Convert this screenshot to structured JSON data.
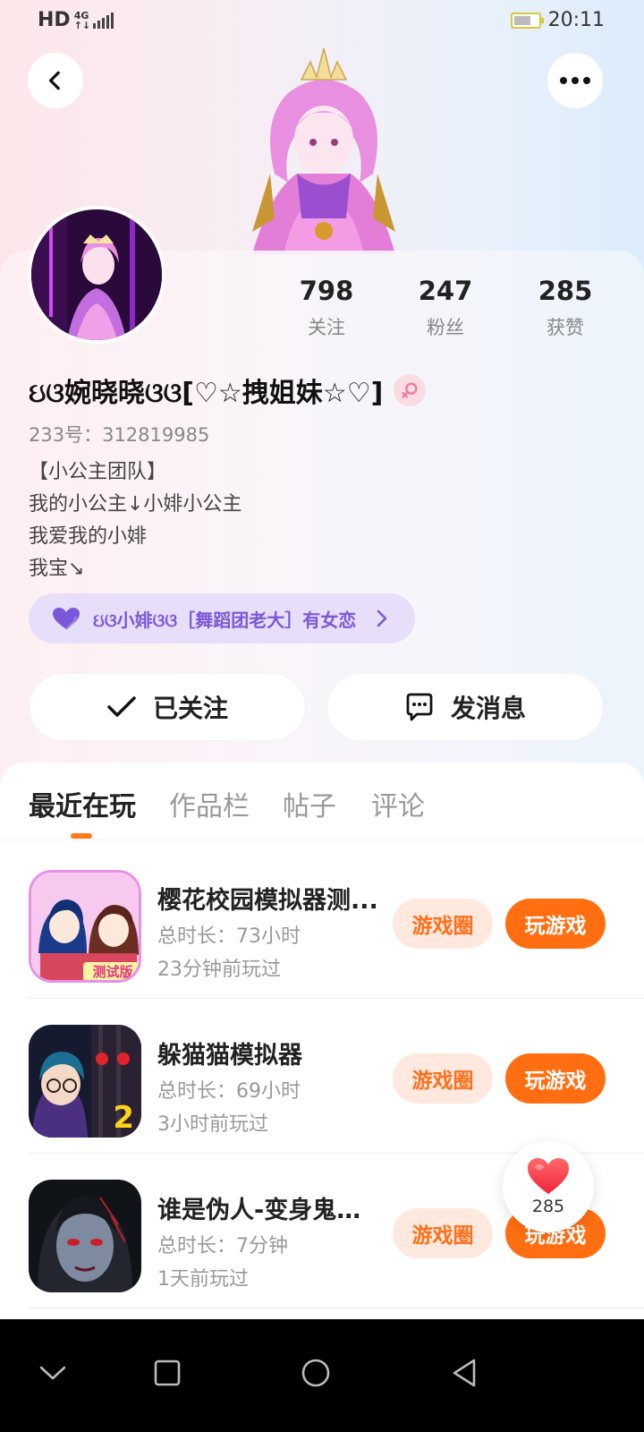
{
  "status_bar": {
    "hd": "HD",
    "network_top": "4G",
    "network_bottom": "↑↓",
    "time": "20:11",
    "battery_level": 0.7
  },
  "header": {
    "back_icon": "chevron-left-icon",
    "more_icon": "more-dots-icon"
  },
  "profile": {
    "stats": [
      {
        "value": "798",
        "label": "关注"
      },
      {
        "value": "247",
        "label": "粉丝"
      },
      {
        "value": "285",
        "label": "获赞"
      }
    ],
    "nickname": "ઇଓ婉晓晓ଓଓ[♡☆拽姐妹☆♡]",
    "gender_icon": "female-icon",
    "id_text": "233号：312819985",
    "bio_lines": [
      "【小公主团队】",
      "我的小公主↓小婔小公主",
      "我爱我的小婔",
      "我宝↘"
    ],
    "relation_chip": "ઇଓ小婔ଓଓ［舞蹈团老大］有女恋"
  },
  "actions": {
    "follow_label": "已关注",
    "message_label": "发消息"
  },
  "tabs": [
    {
      "label": "最近在玩",
      "active": true
    },
    {
      "label": "作品栏",
      "active": false
    },
    {
      "label": "帖子",
      "active": false
    },
    {
      "label": "评论",
      "active": false
    }
  ],
  "games": [
    {
      "title": "樱花校园模拟器测...",
      "duration": "总时长：73小时",
      "last_played": "23分钟前玩过",
      "circle_label": "游戏圈",
      "play_label": "玩游戏",
      "icon_badge": "测试版"
    },
    {
      "title": "躲猫猫模拟器",
      "duration": "总时长：69小时",
      "last_played": "3小时前玩过",
      "circle_label": "游戏圈",
      "play_label": "玩游戏",
      "icon_badge": "2"
    },
    {
      "title": "谁是伪人-变身鬼新...",
      "duration": "总时长：7分钟",
      "last_played": "1天前玩过",
      "circle_label": "游戏圈",
      "play_label": "玩游戏",
      "icon_badge": ""
    }
  ],
  "like_float": {
    "count": "285",
    "icon": "heart-icon"
  },
  "nav_bar": {
    "icons": [
      "chevron-down-icon",
      "square-icon",
      "circle-icon",
      "triangle-back-icon"
    ]
  },
  "colors": {
    "accent": "#ff6f12",
    "accent_light": "#ffe9de",
    "chip_bg": "#e7defa",
    "chip_text": "#7b57d9"
  }
}
